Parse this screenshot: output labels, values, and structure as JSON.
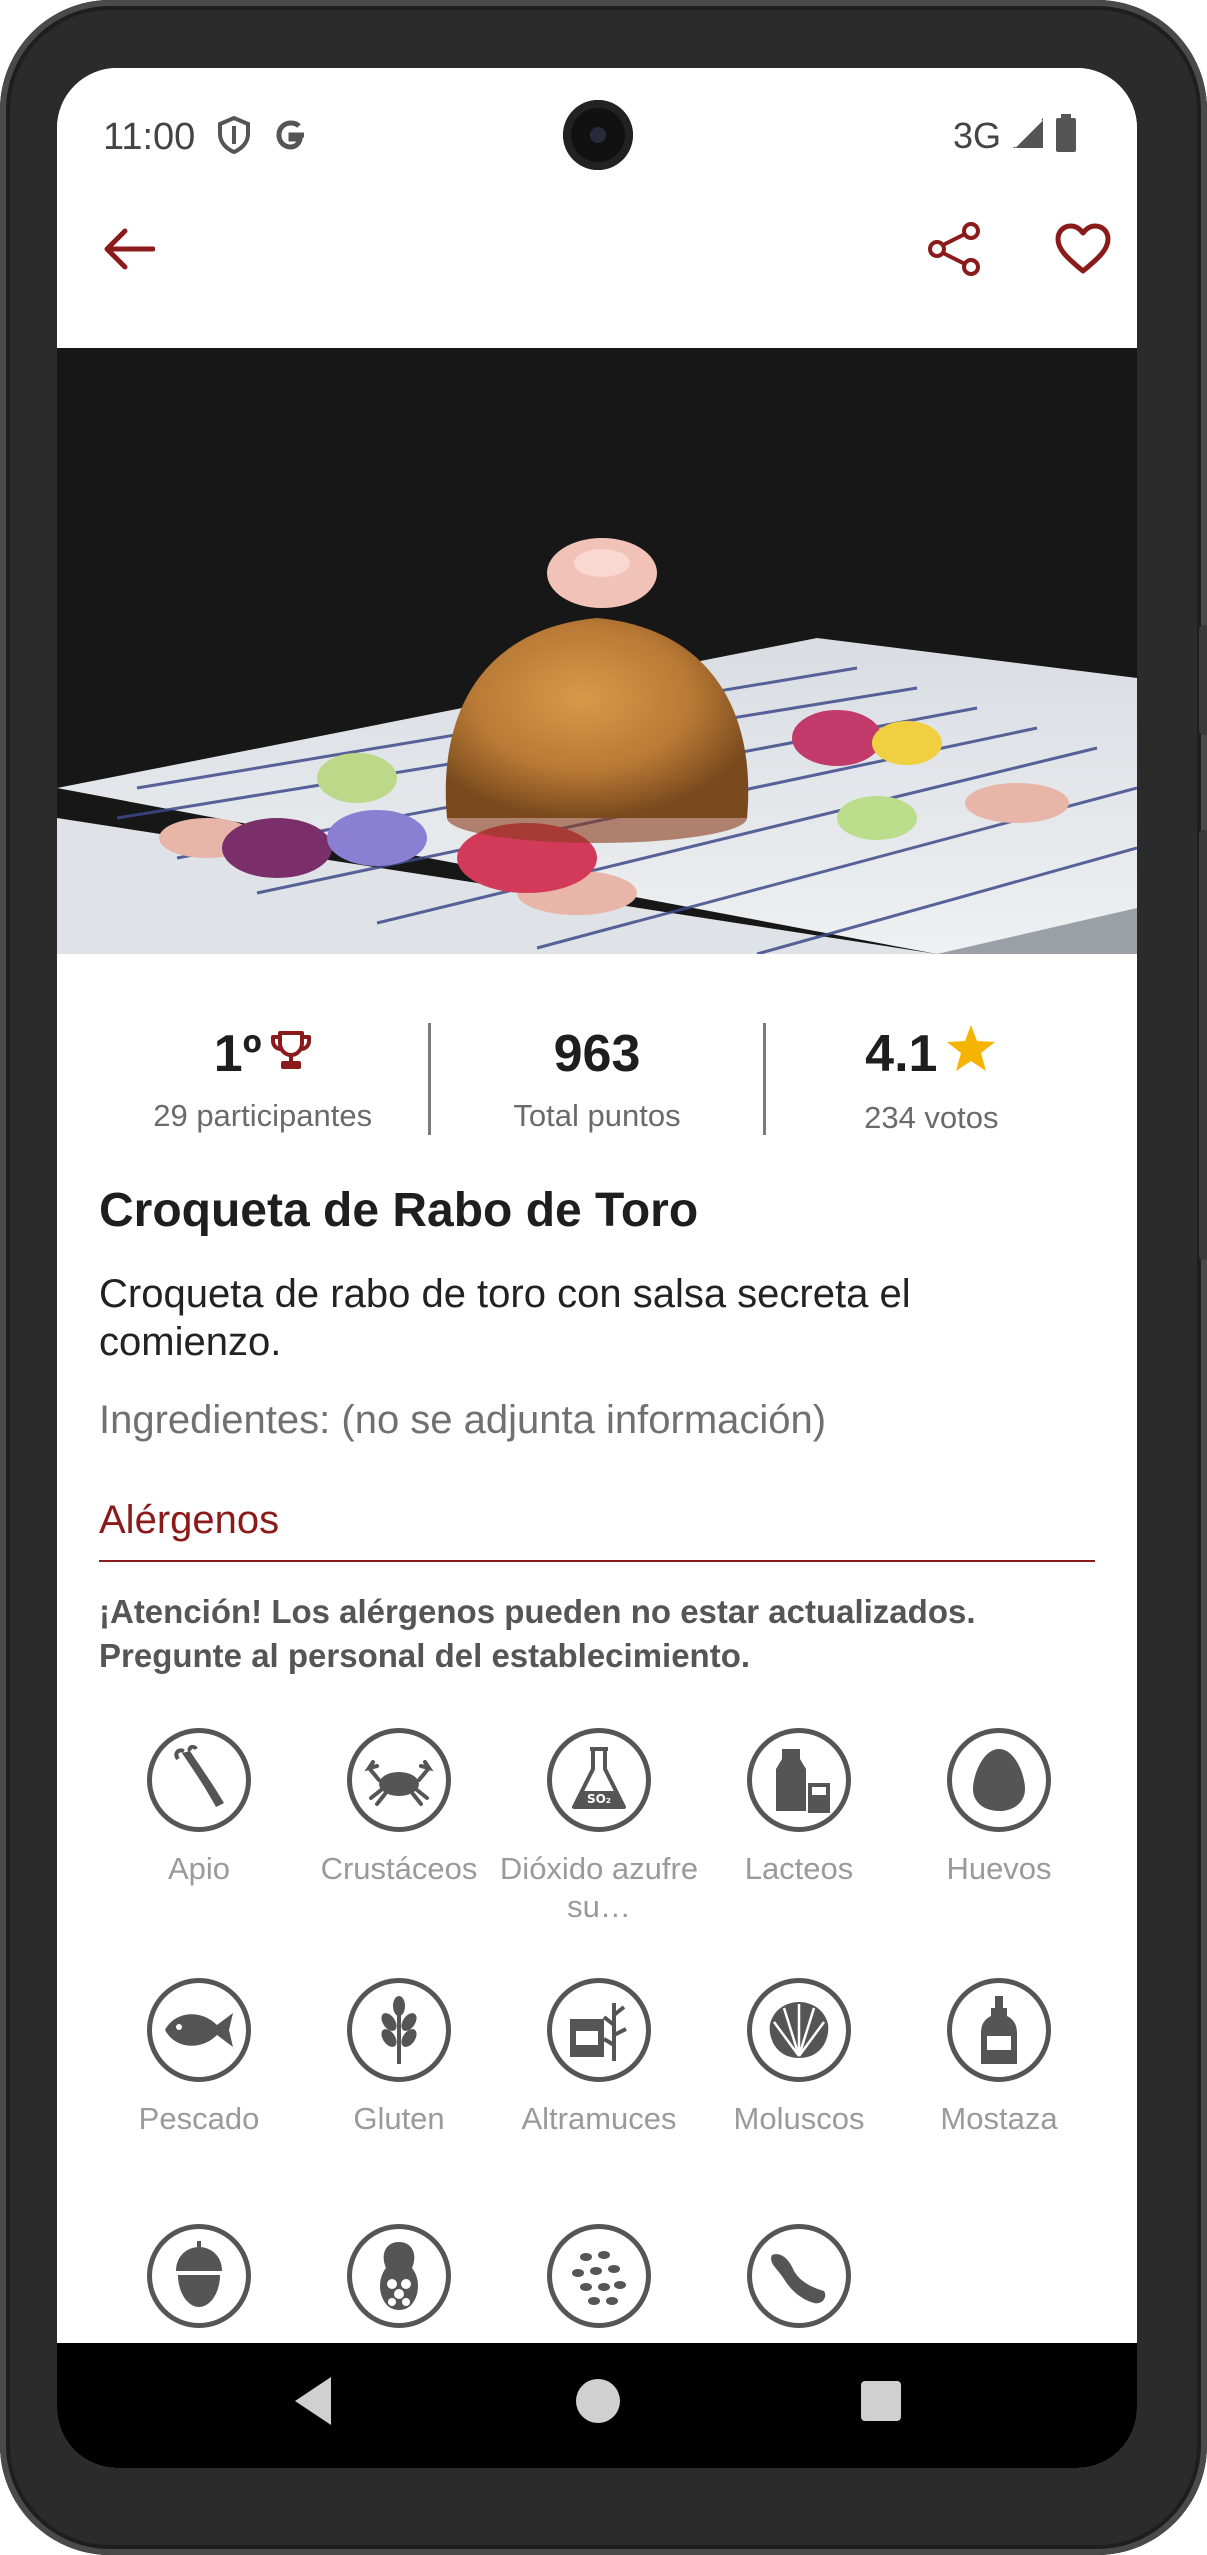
{
  "status_bar": {
    "time": "11:00",
    "network": "3G",
    "left_icons": [
      "shield-icon",
      "google-icon"
    ],
    "right_icons": [
      "signal-icon",
      "battery-icon"
    ]
  },
  "app_bar": {
    "back_icon": "arrow-left-icon",
    "share_icon": "share-icon",
    "favorite_icon": "heart-outline-icon",
    "accent": "#8b1a1a"
  },
  "stats": {
    "rank": "1º",
    "rank_sub": "29 participantes",
    "points": "963",
    "points_sub": "Total puntos",
    "rating": "4.1",
    "rating_sub": "234 votos",
    "star_color": "#f5b400"
  },
  "dish": {
    "title": "Croqueta de Rabo de Toro",
    "description": "Croqueta de rabo de toro con salsa secreta el comienzo.",
    "ingredients": "Ingredientes: (no se adjunta información)"
  },
  "allergens": {
    "header": "Alérgenos",
    "warning": "¡Atención! Los alérgenos pueden no estar actualizados. Pregunte al personal del establecimiento.",
    "items": [
      {
        "label": "Apio",
        "icon": "celery-icon"
      },
      {
        "label": "Crustáceos",
        "icon": "crab-icon"
      },
      {
        "label": "Dióxido azufre su…",
        "icon": "flask-so2-icon"
      },
      {
        "label": "Lacteos",
        "icon": "milk-icon"
      },
      {
        "label": "Huevos",
        "icon": "egg-icon"
      },
      {
        "label": "Pescado",
        "icon": "fish-icon"
      },
      {
        "label": "Gluten",
        "icon": "wheat-icon"
      },
      {
        "label": "Altramuces",
        "icon": "lupin-icon"
      },
      {
        "label": "Moluscos",
        "icon": "shell-icon"
      },
      {
        "label": "Mostaza",
        "icon": "mustard-icon"
      },
      {
        "label": "",
        "icon": "nut-icon"
      },
      {
        "label": "",
        "icon": "peanut-icon"
      },
      {
        "label": "",
        "icon": "sesame-icon"
      },
      {
        "label": "",
        "icon": "soy-icon"
      }
    ]
  },
  "nav": {
    "back": "nav-back-icon",
    "home": "nav-home-icon",
    "recents": "nav-recents-icon"
  }
}
